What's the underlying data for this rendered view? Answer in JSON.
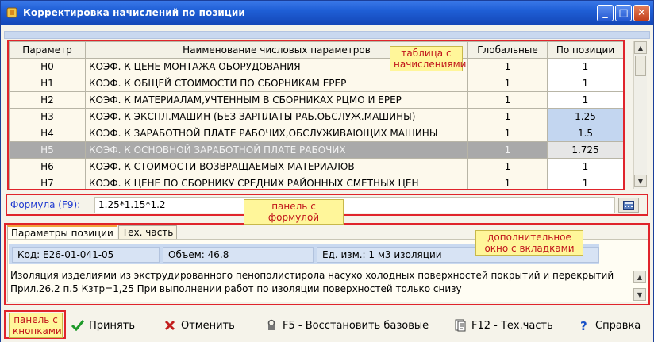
{
  "window": {
    "title": "Корректировка начислений по позиции",
    "controls": {
      "minimize": "_",
      "maximize": "□",
      "close": "✕"
    }
  },
  "table": {
    "headers": [
      "Параметр",
      "Наименование числовых параметров",
      "Глобальные",
      "По позиции"
    ],
    "rows": [
      {
        "param": "H0",
        "name": "КОЭФ. К ЦЕНЕ МОНТАЖА ОБОРУДОВАНИЯ",
        "global": "1",
        "position": "1",
        "changed": false,
        "selected": false
      },
      {
        "param": "H1",
        "name": "КОЭФ. К ОБЩЕЙ СТОИМОСТИ ПО СБОРНИКАМ ЕРЕР",
        "global": "1",
        "position": "1",
        "changed": false,
        "selected": false
      },
      {
        "param": "H2",
        "name": "КОЭФ. К МАТЕРИАЛАМ,УЧТЕННЫМ В СБОРНИКАХ РЦМО И ЕРЕР",
        "global": "1",
        "position": "1",
        "changed": false,
        "selected": false
      },
      {
        "param": "H3",
        "name": "КОЭФ. К ЭКСПЛ.МАШИН (БЕЗ ЗАРПЛАТЫ РАБ.ОБСЛУЖ.МАШИНЫ)",
        "global": "1",
        "position": "1.25",
        "changed": true,
        "selected": false
      },
      {
        "param": "H4",
        "name": "КОЭФ. К ЗАРАБОТНОЙ ПЛАТЕ РАБОЧИХ,ОБСЛУЖИВАЮЩИХ МАШИНЫ",
        "global": "1",
        "position": "1.5",
        "changed": true,
        "selected": false
      },
      {
        "param": "H5",
        "name": "КОЭФ. К ОСНОВНОЙ ЗАРАБОТНОЙ ПЛАТЕ РАБОЧИХ",
        "global": "1",
        "position": "1.725",
        "changed": true,
        "selected": true
      },
      {
        "param": "H6",
        "name": "КОЭФ. К СТОИМОСТИ ВОЗВРАЩАЕМЫХ МАТЕРИАЛОВ",
        "global": "1",
        "position": "1",
        "changed": false,
        "selected": false
      },
      {
        "param": "H7",
        "name": "КОЭФ. К ЦЕНЕ ПО СБОРНИКУ СРЕДНИХ РАЙОННЫХ СМЕТНЫХ ЦЕН",
        "global": "1",
        "position": "1",
        "changed": false,
        "selected": false
      }
    ]
  },
  "annotations": {
    "table": "таблица с начислениями",
    "formula": "панель с формулой",
    "extra": "дополнительное окно с вкладками",
    "buttons": "панель с кнопками"
  },
  "formula": {
    "label": "Формула (F9):",
    "value": "1.25*1.15*1.2"
  },
  "tabs": [
    {
      "label": "Параметры позиции",
      "active": true
    },
    {
      "label": "Тех. часть",
      "active": false
    }
  ],
  "position_info": {
    "code": "Код: E26-01-041-05",
    "volume": "Объем: 46.8",
    "unit": "Ед. изм.: 1 м3 изоляции",
    "description_line1": "Изоляция изделиями из экструдированного пенополистирола насухо холодных поверхностей покрытий и перекрытий",
    "description_line2": "Прил.26.2 п.5  Кзтр=1,25 При выполнении работ по изоляции поверхностей только снизу"
  },
  "buttons": {
    "accept": "Принять",
    "cancel": "Отменить",
    "restore": "F5 - Восстановить базовые",
    "tech": "F12 - Тех.часть",
    "help": "Справка"
  },
  "colors": {
    "accept_icon": "#1e9a2a",
    "cancel_icon": "#c21d1d",
    "help_icon": "#1a52c8",
    "annotation_border": "#e0242b",
    "annotation_fill": "#fff69a"
  }
}
